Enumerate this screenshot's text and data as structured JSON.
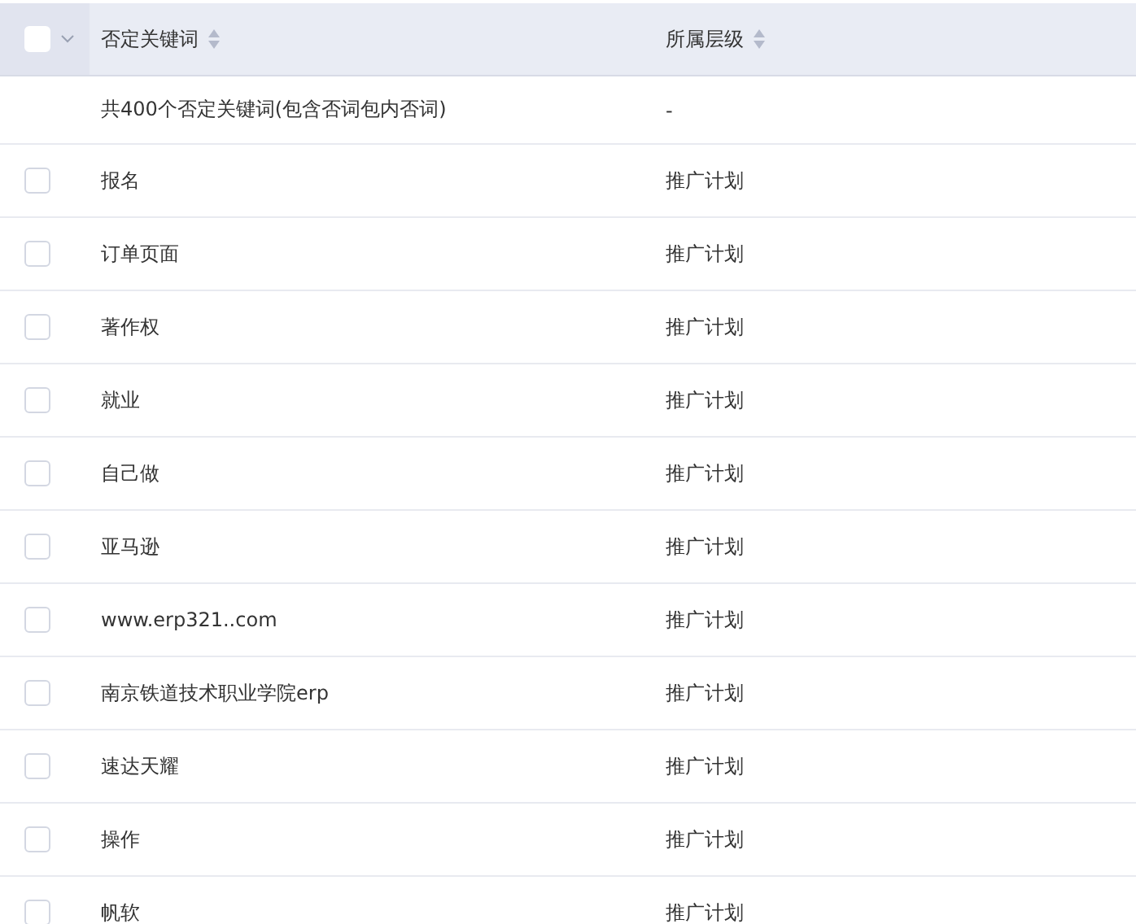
{
  "table": {
    "header": {
      "checked": false,
      "columns": [
        {
          "label": "否定关键词"
        },
        {
          "label": "所属层级"
        }
      ]
    },
    "summary": {
      "keyword": "共400个否定关键词(包含否词包内否词)",
      "level": "-"
    },
    "rows": [
      {
        "keyword": "报名",
        "level": "推广计划",
        "checked": false
      },
      {
        "keyword": "订单页面",
        "level": "推广计划",
        "checked": false
      },
      {
        "keyword": "著作权",
        "level": "推广计划",
        "checked": false
      },
      {
        "keyword": "就业",
        "level": "推广计划",
        "checked": false
      },
      {
        "keyword": "自己做",
        "level": "推广计划",
        "checked": false
      },
      {
        "keyword": "亚马逊",
        "level": "推广计划",
        "checked": false
      },
      {
        "keyword": "www.erp321..com",
        "level": "推广计划",
        "checked": false
      },
      {
        "keyword": "南京铁道技术职业学院erp",
        "level": "推广计划",
        "checked": false
      },
      {
        "keyword": "速达天耀",
        "level": "推广计划",
        "checked": false
      },
      {
        "keyword": "操作",
        "level": "推广计划",
        "checked": false
      },
      {
        "keyword": "帆软",
        "level": "推广计划",
        "checked": false
      }
    ]
  }
}
